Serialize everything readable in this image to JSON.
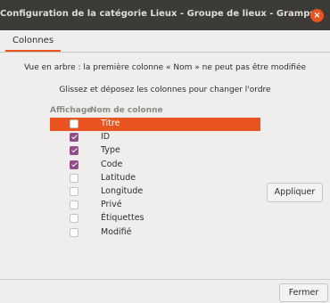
{
  "window": {
    "title": "Configuration de la catégorie Lieux - Groupe de lieux - Gramps",
    "close_icon": "close-icon"
  },
  "tabs": [
    {
      "label": "Colonnes"
    }
  ],
  "info": {
    "line1": "Vue en arbre : la première colonne « Nom » ne peut pas être modifiée",
    "line2": "Glissez et déposez les colonnes pour changer l'ordre"
  },
  "columns_header": {
    "display": "Affichage",
    "name": "Nom de colonne"
  },
  "columns": [
    {
      "label": "Titre",
      "checked": false,
      "selected": true
    },
    {
      "label": "ID",
      "checked": true
    },
    {
      "label": "Type",
      "checked": true
    },
    {
      "label": "Code",
      "checked": true
    },
    {
      "label": "Latitude",
      "checked": false
    },
    {
      "label": "Longitude",
      "checked": false
    },
    {
      "label": "Privé",
      "checked": false
    },
    {
      "label": "Étiquettes",
      "checked": false
    },
    {
      "label": "Modifié",
      "checked": false
    }
  ],
  "buttons": {
    "apply": "Appliquer",
    "close": "Fermer"
  },
  "colors": {
    "accent": "#e95420",
    "checkbox": "#924d8b",
    "titlebar": "#3c3b37"
  }
}
